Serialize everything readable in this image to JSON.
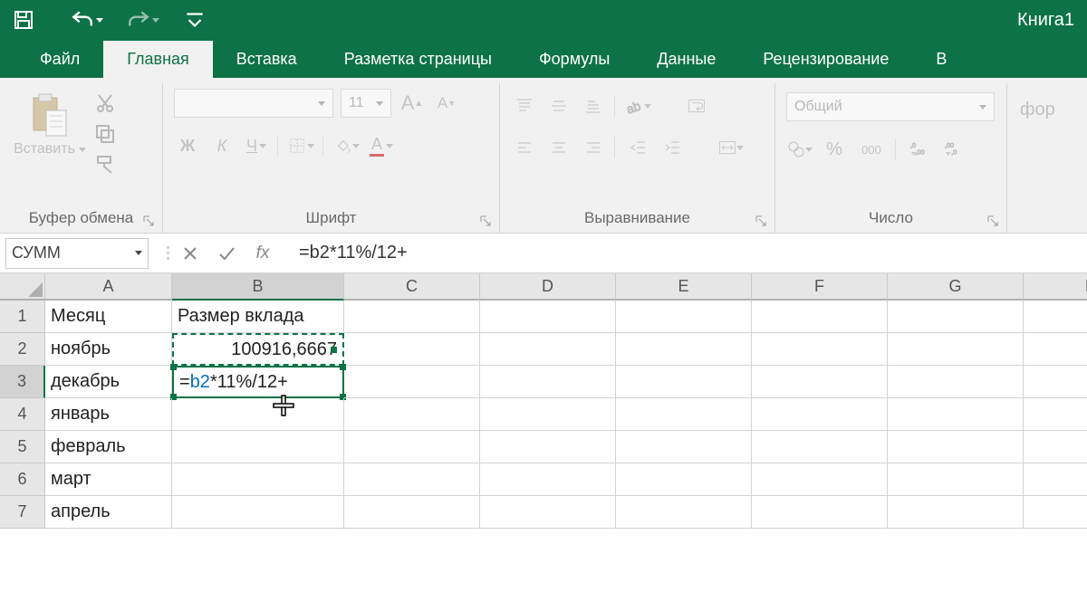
{
  "app": {
    "title": "Книга1"
  },
  "qat": {
    "undo": "undo",
    "redo": "redo"
  },
  "tabs": {
    "file": "Файл",
    "home": "Главная",
    "insert": "Вставка",
    "layout": "Разметка страницы",
    "formulas": "Формулы",
    "data": "Данные",
    "review": "Рецензирование",
    "view_fragment": "В"
  },
  "ribbon": {
    "clipboard": {
      "paste": "Вставить",
      "group_label": "Буфер обмена"
    },
    "font": {
      "size": "11",
      "bold_label": "Ж",
      "italic_label": "К",
      "underline_label": "Ч",
      "increase_font": "A",
      "decrease_font": "A",
      "font_color": "A",
      "group_label": "Шрифт"
    },
    "alignment": {
      "group_label": "Выравнивание"
    },
    "number": {
      "format": "Общий",
      "percent": "%",
      "thousands": "000",
      "group_label": "Число"
    },
    "format_fragment": "фор"
  },
  "formula_bar": {
    "name_box": "СУММ",
    "fx_label": "fx",
    "formula": "=b2*11%/12+"
  },
  "grid": {
    "columns": [
      "A",
      "B",
      "C",
      "D",
      "E",
      "F",
      "G",
      "H"
    ],
    "active_column": "B",
    "active_row": 3,
    "rows": [
      {
        "n": 1,
        "A": "Месяц",
        "B": "Размер вклада"
      },
      {
        "n": 2,
        "A": "ноябрь",
        "B": "100916,6667"
      },
      {
        "n": 3,
        "A": "декабрь",
        "B_prefix": "=",
        "B_ref": "b2",
        "B_suffix": "*11%/12+"
      },
      {
        "n": 4,
        "A": "январь",
        "B": ""
      },
      {
        "n": 5,
        "A": "февраль",
        "B": ""
      },
      {
        "n": 6,
        "A": "март",
        "B": ""
      },
      {
        "n": 7,
        "A": "апрель",
        "B": ""
      }
    ]
  }
}
